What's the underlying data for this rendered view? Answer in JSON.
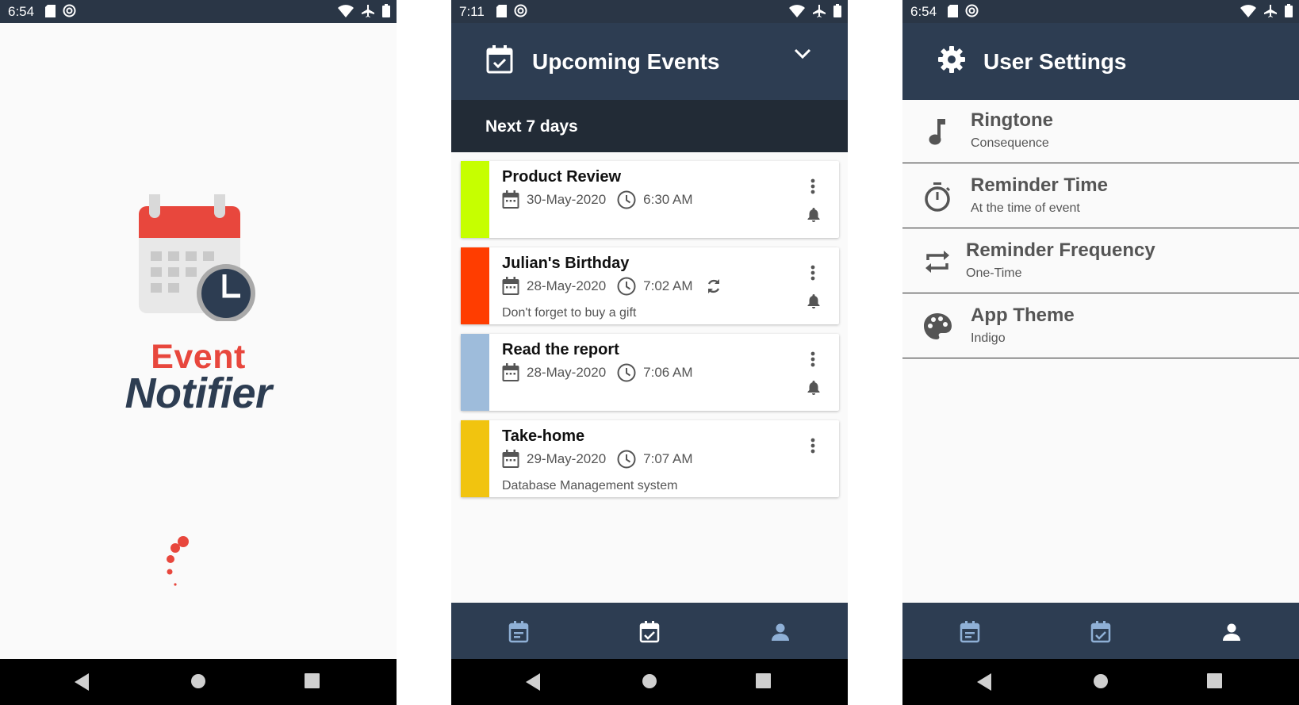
{
  "splash": {
    "status_time": "6:54",
    "brand_event": "Event",
    "brand_notifier": "Notifier"
  },
  "events": {
    "status_time": "7:11",
    "header_title": "Upcoming Events",
    "subheader": "Next 7 days",
    "items": [
      {
        "title": "Product Review",
        "date": "30-May-2020",
        "time": "6:30 AM",
        "note": "",
        "color": "#c6ff00",
        "repeat": false,
        "bell": true
      },
      {
        "title": "Julian's Birthday",
        "date": "28-May-2020",
        "time": "7:02 AM",
        "note": "Don't forget to buy a gift",
        "color": "#ff3d00",
        "repeat": true,
        "bell": true
      },
      {
        "title": "Read the report",
        "date": "28-May-2020",
        "time": "7:06 AM",
        "note": "",
        "color": "#9ebcdb",
        "repeat": false,
        "bell": true
      },
      {
        "title": "Take-home",
        "date": "29-May-2020",
        "time": "7:07 AM",
        "note": "Database Management system",
        "color": "#f1c40f",
        "repeat": false,
        "bell": false
      }
    ]
  },
  "settings": {
    "status_time": "6:54",
    "header_title": "User Settings",
    "items": [
      {
        "title": "Ringtone",
        "subtitle": "Consequence",
        "icon": "music-note-icon"
      },
      {
        "title": "Reminder Time",
        "subtitle": "At the time of event",
        "icon": "stopwatch-icon"
      },
      {
        "title": "Reminder Frequency",
        "subtitle": "One-Time",
        "icon": "repeat-icon"
      },
      {
        "title": "App Theme",
        "subtitle": "Indigo",
        "icon": "palette-icon"
      }
    ]
  },
  "colors": {
    "primary": "#2d3d52",
    "statusbar": "#2a3646",
    "subheader": "#222b36",
    "accent_red": "#e8473d",
    "tab_inactive": "#8fb0d6",
    "tab_active": "#ffffff"
  }
}
